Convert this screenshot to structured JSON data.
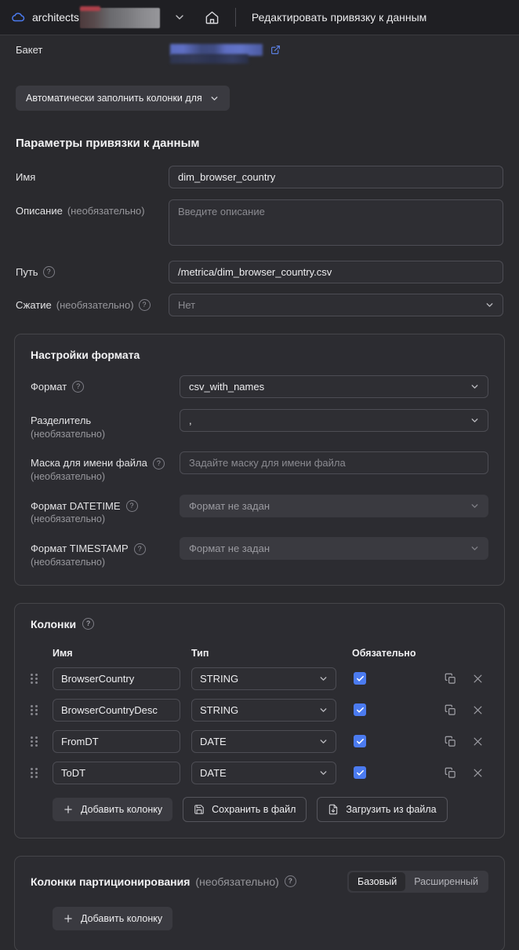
{
  "topbar": {
    "org": "architects",
    "title": "Редактировать привязку к данным",
    "cloud_icon": "cloud-icon",
    "chevron_icon": "chevron-down-icon",
    "home_icon": "home-icon"
  },
  "bucket": {
    "label": "Бакет",
    "value": "",
    "external_link_icon": "external-link-icon"
  },
  "autofill": {
    "label": "Автоматически заполнить колонки для"
  },
  "params": {
    "title": "Параметры привязки к данным",
    "name": {
      "label": "Имя",
      "value": "dim_browser_country"
    },
    "description": {
      "label": "Описание",
      "optional": "(необязательно)",
      "value": "",
      "placeholder": "Введите описание"
    },
    "path": {
      "label": "Путь",
      "value": "/metrica/dim_browser_country.csv"
    },
    "compression": {
      "label": "Сжатие",
      "optional": "(необязательно)",
      "value": "Нет"
    }
  },
  "format": {
    "title": "Настройки формата",
    "format": {
      "label": "Формат",
      "value": "csv_with_names"
    },
    "delimiter": {
      "label": "Разделитель",
      "optional": "(необязательно)",
      "value": ","
    },
    "filemask": {
      "label": "Маска для имени файла",
      "optional": "(необязательно)",
      "value": "",
      "placeholder": "Задайте маску для имени файла"
    },
    "datetime": {
      "label": "Формат DATETIME",
      "optional": "(необязательно)",
      "value": "Формат не задан"
    },
    "timestamp": {
      "label": "Формат TIMESTAMP",
      "optional": "(необязательно)",
      "value": "Формат не задан"
    }
  },
  "columns": {
    "title": "Колонки",
    "headers": {
      "name": "Имя",
      "type": "Тип",
      "required": "Обязательно"
    },
    "rows": [
      {
        "name": "BrowserCountry",
        "type": "STRING",
        "required": true
      },
      {
        "name": "BrowserCountryDesc",
        "type": "STRING",
        "required": true
      },
      {
        "name": "FromDT",
        "type": "DATE",
        "required": true
      },
      {
        "name": "ToDT",
        "type": "DATE",
        "required": true
      }
    ],
    "add_label": "Добавить колонку",
    "save_label": "Сохранить в файл",
    "load_label": "Загрузить из файла"
  },
  "partition": {
    "title": "Колонки партиционирования",
    "optional": "(необязательно)",
    "modes": [
      "Базовый",
      "Расширенный"
    ],
    "active_mode": "Базовый",
    "add_label": "Добавить колонку"
  },
  "colors": {
    "accent": "#4b7bf0",
    "link": "#5b7fe0",
    "bg": "#2a2a2e",
    "topbar_bg": "#1f1f23",
    "panel_bg": "#2c2c31",
    "input_bg": "#2e2e33",
    "border": "#4d4d54"
  }
}
